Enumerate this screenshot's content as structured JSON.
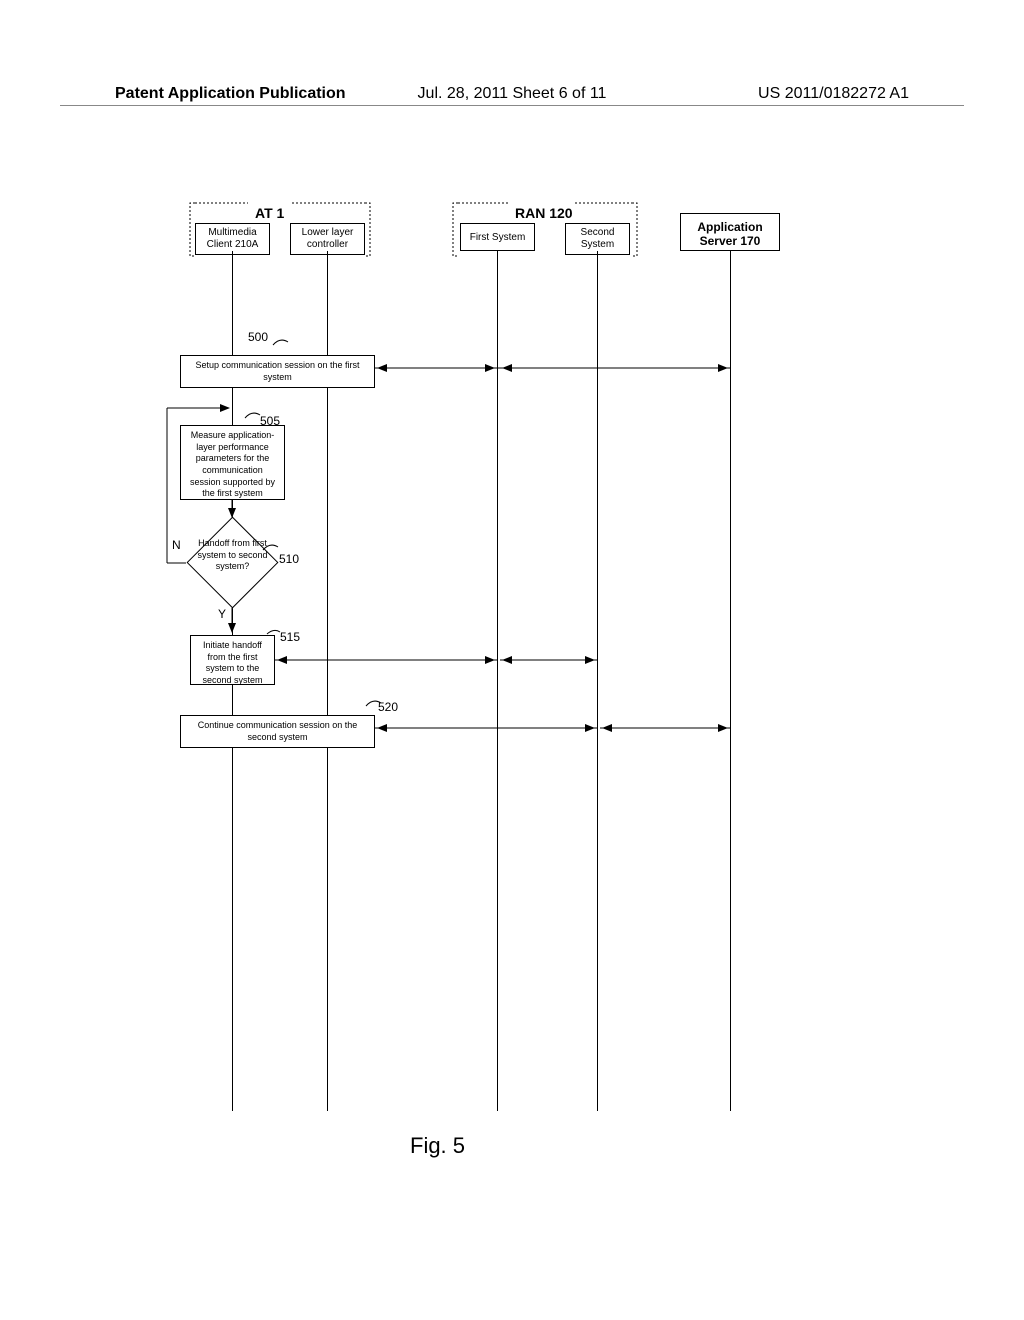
{
  "header": {
    "left": "Patent Application Publication",
    "center": "Jul. 28, 2011   Sheet 6 of 11",
    "right": "US 2011/0182272 A1"
  },
  "groups": {
    "at1": "AT 1",
    "ran": "RAN 120"
  },
  "lifelines": {
    "multimedia_client": "Multimedia Client 210A",
    "lower_layer": "Lower layer controller",
    "first_system": "First System",
    "second_system": "Second System",
    "app_server": "Application Server 170"
  },
  "steps": {
    "s500": "Setup communication session on the first system",
    "s505": "Measure application-layer performance parameters for the communication session supported by the first system",
    "s510": "Handoff from first system to second system?",
    "s515": "Initiate handoff from the first system to the second system",
    "s520": "Continue communication session on the second system"
  },
  "refs": {
    "r500": "500",
    "r505": "505",
    "r510": "510",
    "r515": "515",
    "r520": "520"
  },
  "decision_labels": {
    "no": "N",
    "yes": "Y"
  },
  "figure": "Fig. 5"
}
